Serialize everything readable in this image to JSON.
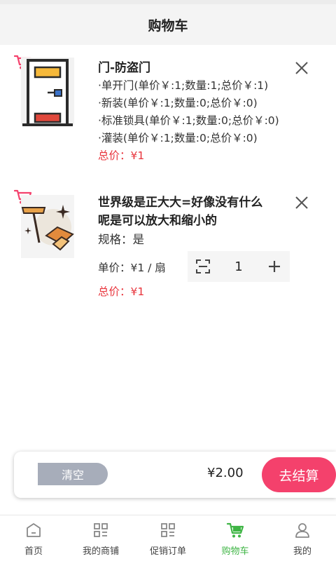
{
  "header": {
    "title": "购物车"
  },
  "cart": {
    "items": [
      {
        "name": "门-防盗门",
        "specs": [
          "·单开门(单价￥:1;数量:1;总价￥:1)",
          "·新装(单价￥:1;数量:0;总价￥:0)",
          "·标准锁具(单价￥:1;数量:0;总价￥:0)",
          "·灌装(单价￥:1;数量:0;总价￥:0)"
        ],
        "total": "总价：¥1"
      },
      {
        "name_line1": "世界级是正大大=好像没有什么",
        "name_line2": "呢是可以放大和缩小的",
        "spec": "规格：是",
        "unit_price": "单价：¥1 / 扇",
        "quantity": "1",
        "total": "总价：¥1"
      }
    ]
  },
  "summary": {
    "clear_label": "清空",
    "amount": "¥2.00",
    "checkout_label": "去结算"
  },
  "tabbar": {
    "items": [
      {
        "label": "首页",
        "icon": "home-icon"
      },
      {
        "label": "我的商铺",
        "icon": "shop-icon"
      },
      {
        "label": "促销订单",
        "icon": "order-icon"
      },
      {
        "label": "购物车",
        "icon": "cart-icon",
        "active": true
      },
      {
        "label": "我的",
        "icon": "user-icon"
      }
    ]
  },
  "colors": {
    "accent_red": "#e8343c",
    "checkout_pink": "#f4416c",
    "active_green": "#3fb545",
    "clear_gray": "#a7adba"
  }
}
